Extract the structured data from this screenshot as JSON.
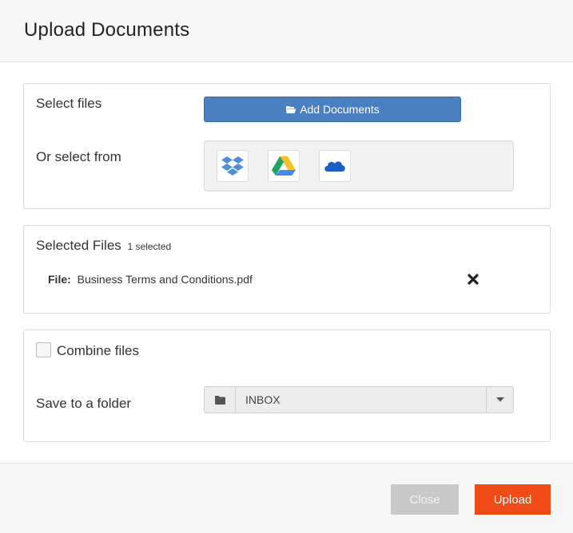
{
  "dialog": {
    "title": "Upload Documents"
  },
  "select_files": {
    "label": "Select files",
    "add_button_label": "Add Documents",
    "or_select_label": "Or select from",
    "sources": [
      "dropbox-icon",
      "google-drive-icon",
      "onedrive-icon"
    ]
  },
  "selected_files": {
    "title": "Selected Files",
    "count": "1 selected",
    "files": [
      {
        "prefix": "File:",
        "name": "Business Terms and Conditions.pdf"
      }
    ]
  },
  "options": {
    "combine_label": "Combine files",
    "combine_checked": false,
    "save_label": "Save to a folder",
    "folder_value": "INBOX"
  },
  "footer": {
    "close_label": "Close",
    "upload_label": "Upload"
  },
  "colors": {
    "primary": "#4a7fc0",
    "upload": "#f04a17",
    "close": "#c8c8c8"
  }
}
